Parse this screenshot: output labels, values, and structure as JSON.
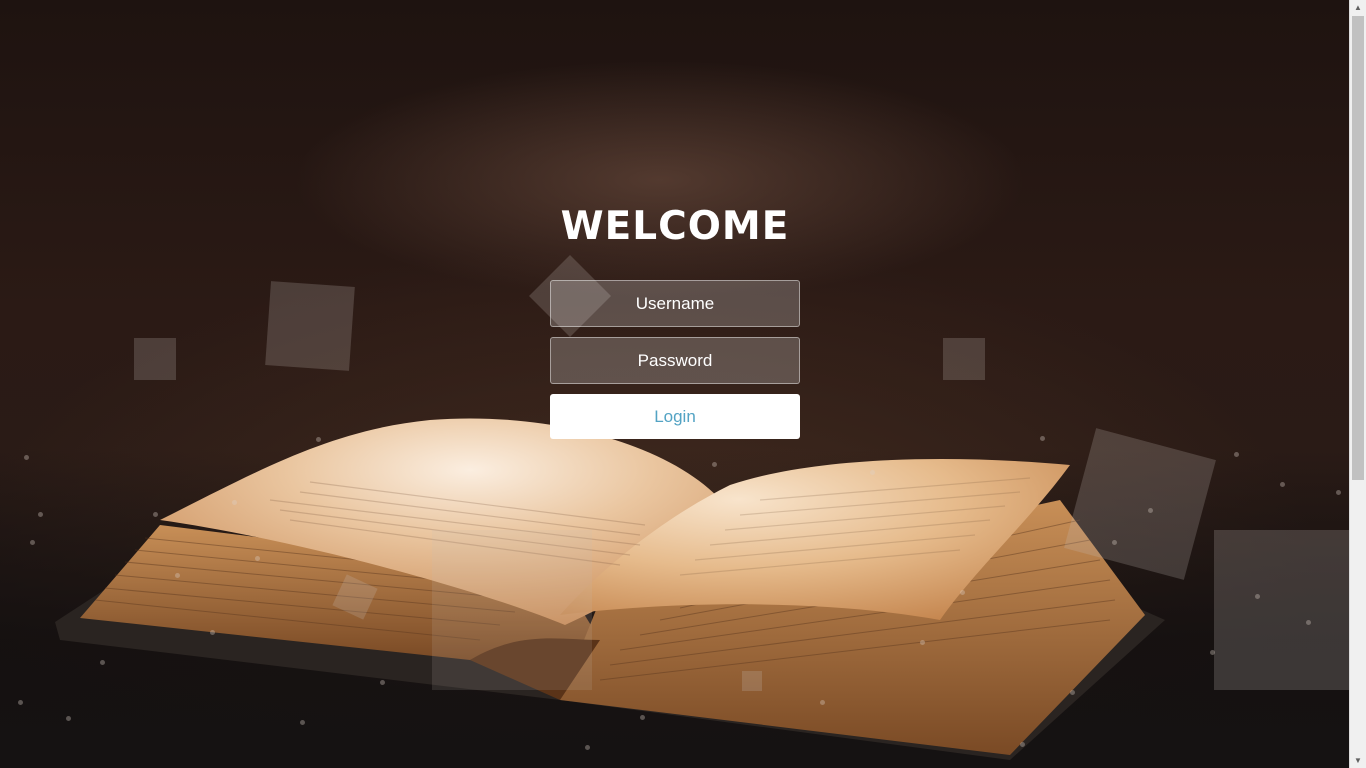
{
  "login": {
    "title": "WELCOME",
    "username_placeholder": "Username",
    "password_placeholder": "Password",
    "login_label": "Login"
  },
  "scrollbar": {
    "up_icon": "chevron-up-icon",
    "down_icon": "chevron-down-icon"
  },
  "colors": {
    "button_text": "#53a3c4",
    "button_bg": "#ffffff",
    "title": "#ffffff"
  }
}
